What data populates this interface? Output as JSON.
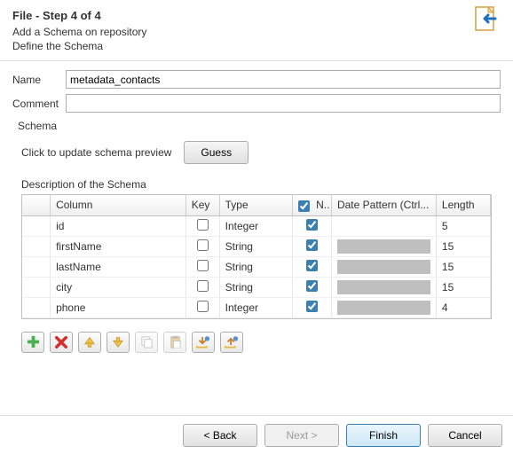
{
  "banner": {
    "title": "File - Step 4 of 4",
    "subtitle_line1": "Add a Schema on repository",
    "subtitle_line2": "Define the Schema"
  },
  "form": {
    "name_label": "Name",
    "name_value": "metadata_contacts",
    "comment_label": "Comment",
    "comment_value": ""
  },
  "group": {
    "title": "Schema",
    "update_label": "Click to update schema preview",
    "guess_label": "Guess",
    "desc_label": "Description of the Schema"
  },
  "table": {
    "headers": {
      "column": "Column",
      "key": "Key",
      "type": "Type",
      "null": "N..",
      "date": "Date Pattern (Ctrl...",
      "length": "Length"
    },
    "header_null_checked": true,
    "rows": [
      {
        "column": "id",
        "key": false,
        "type": "Integer",
        "null": true,
        "date_shaded": false,
        "length": "5"
      },
      {
        "column": "firstName",
        "key": false,
        "type": "String",
        "null": true,
        "date_shaded": true,
        "length": "15"
      },
      {
        "column": "lastName",
        "key": false,
        "type": "String",
        "null": true,
        "date_shaded": true,
        "length": "15"
      },
      {
        "column": "city",
        "key": false,
        "type": "String",
        "null": true,
        "date_shaded": true,
        "length": "15"
      },
      {
        "column": "phone",
        "key": false,
        "type": "Integer",
        "null": true,
        "date_shaded": true,
        "length": "4"
      }
    ]
  },
  "toolbar": {
    "add": "add-icon",
    "remove": "remove-icon",
    "up": "up-icon",
    "down": "down-icon",
    "copy": "copy-icon",
    "paste": "paste-icon",
    "import": "import-icon",
    "export": "export-icon"
  },
  "footer": {
    "back": "< Back",
    "next": "Next >",
    "finish": "Finish",
    "cancel": "Cancel"
  }
}
